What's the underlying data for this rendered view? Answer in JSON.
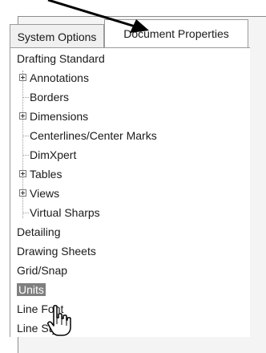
{
  "tabs": {
    "system_options": "System Options",
    "document_properties": "Document Properties"
  },
  "tree": {
    "items": [
      {
        "label": "Drafting Standard"
      },
      {
        "label": "Annotations"
      },
      {
        "label": "Borders"
      },
      {
        "label": "Dimensions"
      },
      {
        "label": "Centerlines/Center Marks"
      },
      {
        "label": "DimXpert"
      },
      {
        "label": "Tables"
      },
      {
        "label": "Views"
      },
      {
        "label": "Virtual Sharps"
      },
      {
        "label": "Detailing"
      },
      {
        "label": "Drawing Sheets"
      },
      {
        "label": "Grid/Snap"
      },
      {
        "label": "Units"
      },
      {
        "label": "Line Font"
      },
      {
        "label": "Line Style"
      }
    ],
    "selected": "Units"
  },
  "colors": {
    "selection": "#7f7f7f",
    "arrow": "#000000"
  },
  "icons": {
    "pointer": "hand-pointer-icon",
    "expander": "plus-box-icon"
  }
}
